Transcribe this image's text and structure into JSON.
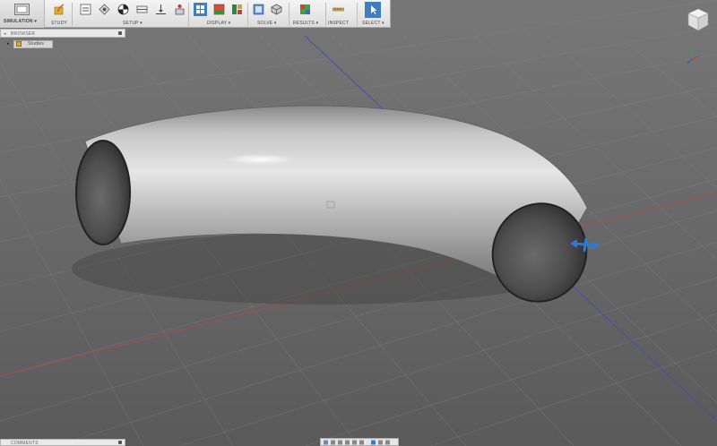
{
  "toolbar": {
    "workspace_label": "SIMULATION ▾",
    "groups": {
      "study": "STUDY",
      "setup": "SETUP ▾",
      "display": "DISPLAY ▾",
      "solve": "SOLVE ▾",
      "results": "RESULTS ▾",
      "inspect": "INSPECT",
      "select": "SELECT ▾"
    }
  },
  "browser": {
    "title": "BROWSER",
    "items": [
      {
        "label": "Studies"
      }
    ]
  },
  "comments": {
    "title": "COMMENTS"
  },
  "icons": [
    "workspace-icon",
    "study-icon",
    "setup-icon-1",
    "setup-icon-2",
    "setup-icon-3",
    "setup-icon-4",
    "setup-icon-5",
    "setup-icon-6",
    "display-icon-1",
    "display-icon-2",
    "display-icon-3",
    "solve-icon-1",
    "solve-icon-2",
    "results-icon",
    "inspect-icon",
    "select-icon",
    "viewcube-icon",
    "axis-triad-icon",
    "move-manipulator-icon",
    "navigation-bar-icons"
  ],
  "colors": {
    "toolbar_bg": "#e3e3e3",
    "accent_selected": "#3d7fbf",
    "canvas_bg": "#5b5b5b",
    "grid": "#6a6a6a",
    "axis_red": "#b04a4a",
    "axis_blue": "#4a4ab0"
  }
}
